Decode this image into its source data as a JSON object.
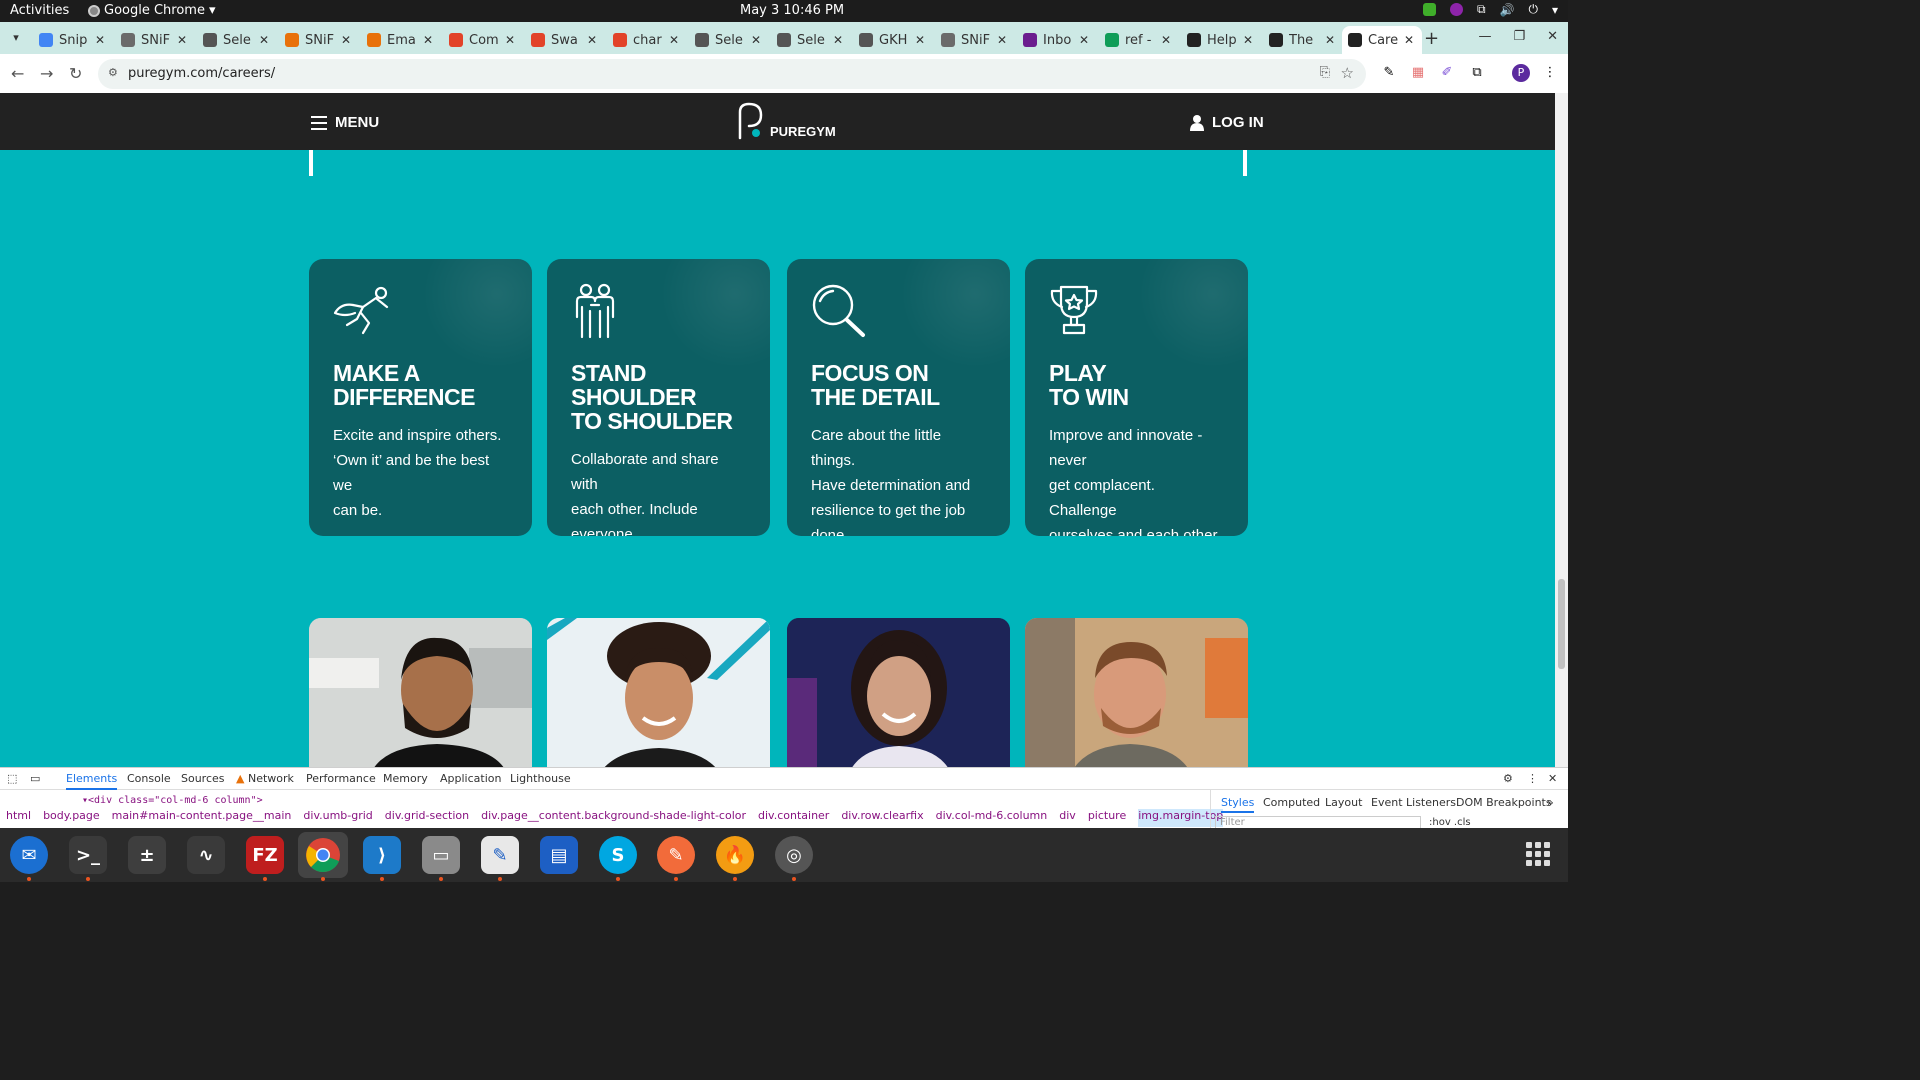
{
  "system": {
    "activities": "Activities",
    "app_name": "Google Chrome",
    "clock": "May 3  10:46 PM"
  },
  "tabs": [
    {
      "label": "Snip",
      "color": "#4285f4"
    },
    {
      "label": "SNiF",
      "color": "#6b6b6b"
    },
    {
      "label": "Sele",
      "color": "#555555"
    },
    {
      "label": "SNiF",
      "color": "#e8710a"
    },
    {
      "label": "Ema",
      "color": "#e8710a"
    },
    {
      "label": "Com",
      "color": "#e24329"
    },
    {
      "label": "Swa",
      "color": "#e24329"
    },
    {
      "label": "char",
      "color": "#e24329"
    },
    {
      "label": "Sele",
      "color": "#555555"
    },
    {
      "label": "Sele",
      "color": "#555555"
    },
    {
      "label": "GKH",
      "color": "#555555"
    },
    {
      "label": "SNiF",
      "color": "#6b6b6b"
    },
    {
      "label": "Inbo",
      "color": "#6b1d8f"
    },
    {
      "label": "ref -",
      "color": "#0f9d58"
    },
    {
      "label": "Help",
      "color": "#222222"
    },
    {
      "label": "The",
      "color": "#222222"
    },
    {
      "label": "Care",
      "color": "#222222"
    }
  ],
  "browser": {
    "url": "puregym.com/careers/",
    "profile_initial": "P"
  },
  "site": {
    "menu_label": "MENU",
    "logo_text": "PUREGYM",
    "login_label": "LOG IN",
    "accent": "#00b5bb",
    "card_color": "#0c5f63"
  },
  "values": [
    {
      "icon": "superhero-icon",
      "title": "MAKE A\nDIFFERENCE",
      "desc": "Excite and inspire others.\n ‘Own it’ and be the best we\ncan be."
    },
    {
      "icon": "two-people-icon",
      "title": "STAND SHOULDER\nTO SHOULDER",
      "desc": "Collaborate and share with\neach other. Include everyone\nand embrace uniqueness."
    },
    {
      "icon": "magnifier-icon",
      "title": "FOCUS ON\nTHE DETAIL",
      "desc": "Care about the little things.\nHave determination and\nresilience to get the job done."
    },
    {
      "icon": "trophy-icon",
      "title": "PLAY\nTO WIN",
      "desc": "Improve and innovate - never\nget complacent. Challenge\nourselves and each other.\nCelebrate our success."
    }
  ],
  "devtools": {
    "tabs": [
      "Elements",
      "Console",
      "Sources",
      "Network",
      "Performance",
      "Memory",
      "Application",
      "Lighthouse"
    ],
    "node": "▾<div class=\"col-md-6 column\">",
    "breadcrumbs": [
      "html",
      "body.page",
      "main#main-content.page__main",
      "div.umb-grid",
      "div.grid-section",
      "div.page__content.background-shade-light-color",
      "div.container",
      "div.row.clearfix",
      "div.col-md-6.column",
      "div",
      "picture",
      "img.margin-top"
    ],
    "side_tabs": [
      "Styles",
      "Computed",
      "Layout",
      "Event Listeners",
      "DOM Breakpoints"
    ],
    "filter_placeholder": "Filter",
    "side_hint": ":hov  .cls"
  }
}
